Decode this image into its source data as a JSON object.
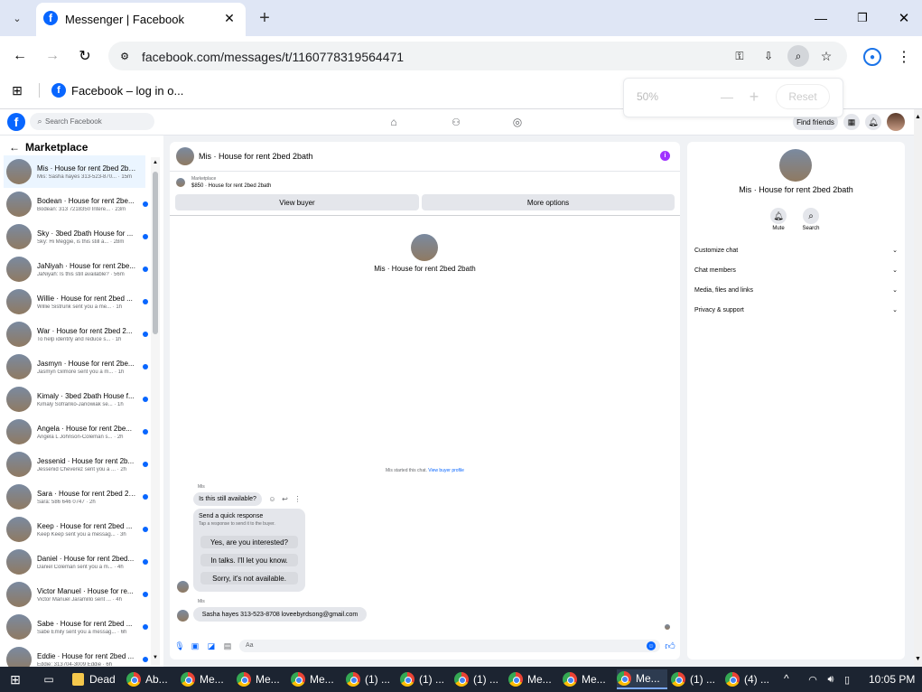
{
  "browser": {
    "tab_title": "Messenger | Facebook",
    "url": "facebook.com/messages/t/1160778319564471",
    "bookmark": "Facebook – log in o...",
    "zoom": {
      "level": "50%",
      "minus": "—",
      "plus": "+",
      "reset": "Reset"
    }
  },
  "fb": {
    "search_placeholder": "Search Facebook",
    "find_friends": "Find friends"
  },
  "sidebar": {
    "title": "Marketplace",
    "threads": [
      {
        "title": "Mis · House for rent 2bed 2bath",
        "preview": "Mis: Sasha hayes 313-523-870... · 15m",
        "unread": false
      },
      {
        "title": "Bodean · House for rent 2be...",
        "preview": "Bodean: 313 7218350 Intere... · 23m",
        "unread": true
      },
      {
        "title": "Sky · 3bed 2bath House for ...",
        "preview": "Sky: Hi Meggie, is this still a... · 28m",
        "unread": true
      },
      {
        "title": "JaNiyah · House for rent 2be...",
        "preview": "JaNiyah: Is this still available? · 56m",
        "unread": true
      },
      {
        "title": "Willie · House for rent 2bed ...",
        "preview": "Willie Sistrunk sent you a me... · 1h",
        "unread": true
      },
      {
        "title": "War · House for rent 2bed 2...",
        "preview": "To help identify and reduce s... · 1h",
        "unread": true
      },
      {
        "title": "Jasmyn · House for rent 2be...",
        "preview": "Jasmyn Gilmore sent you a m... · 1h",
        "unread": true
      },
      {
        "title": "Kimaly · 3bed 2bath House f...",
        "preview": "Kimaly Sofranko-Janowiak se... · 1h",
        "unread": true
      },
      {
        "title": "Angela · House for rent 2be...",
        "preview": "Angela L Johnson-Coleman s... · 2h",
        "unread": true
      },
      {
        "title": "Jessenid · House for rent 2b...",
        "preview": "Jessenid Cheverez sent you a ... · 2h",
        "unread": true
      },
      {
        "title": "Sara · House for rent 2bed 2b...",
        "preview": "Sara: 586 646 0747 · 2h",
        "unread": true
      },
      {
        "title": "Keep · House for rent 2bed ...",
        "preview": "Keep Keep sent you a messag... · 3h",
        "unread": true
      },
      {
        "title": "Daniel · House for rent 2bed...",
        "preview": "Daniel Coleman sent you a m... · 4h",
        "unread": true
      },
      {
        "title": "Victor Manuel · House for re...",
        "preview": "Victor Manuel Jaramillo sent ... · 4h",
        "unread": true
      },
      {
        "title": "Sabe · House for rent 2bed ...",
        "preview": "Sabe Emily sent you a messag... · 6h",
        "unread": true
      },
      {
        "title": "Eddie · House for rent 2bed ...",
        "preview": "Eddie: 313704-3009 Eddie · 6h",
        "unread": true
      }
    ]
  },
  "chat": {
    "header_title": "Mis · House for rent 2bed 2bath",
    "listing_label": "Marketplace",
    "listing_info": "$850 · House for rent 2bed 2bath",
    "view_buyer": "View buyer",
    "more_options": "More options",
    "center_title": "Mis · House for rent 2bed 2bath",
    "started_text": "Mis started this chat.",
    "view_profile": "View buyer profile",
    "sender": "Mis",
    "msg1": "Is this still available?",
    "quick_title": "Send a quick response",
    "quick_sub": "Tap a response to send it to the buyer.",
    "quick": [
      "Yes, are you interested?",
      "In talks. I'll let you know.",
      "Sorry, it's not available."
    ],
    "sender2": "Mis",
    "msg2": "Sasha hayes 313-523-8708 loveebyrdsong@gmail.com",
    "input_placeholder": "Aa"
  },
  "info": {
    "title": "Mis · House for rent 2bed 2bath",
    "mute": "Mute",
    "search": "Search",
    "sections": [
      "Customize chat",
      "Chat members",
      "Media, files and links",
      "Privacy & support"
    ]
  },
  "taskbar": {
    "items": [
      "Dead",
      "Ab...",
      "Me...",
      "Me...",
      "Me...",
      "(1) ...",
      "(1) ...",
      "(1) ...",
      "Me...",
      "Me...",
      "Me...",
      "(1) ...",
      "(4) ..."
    ],
    "clock": "10:05 PM"
  }
}
